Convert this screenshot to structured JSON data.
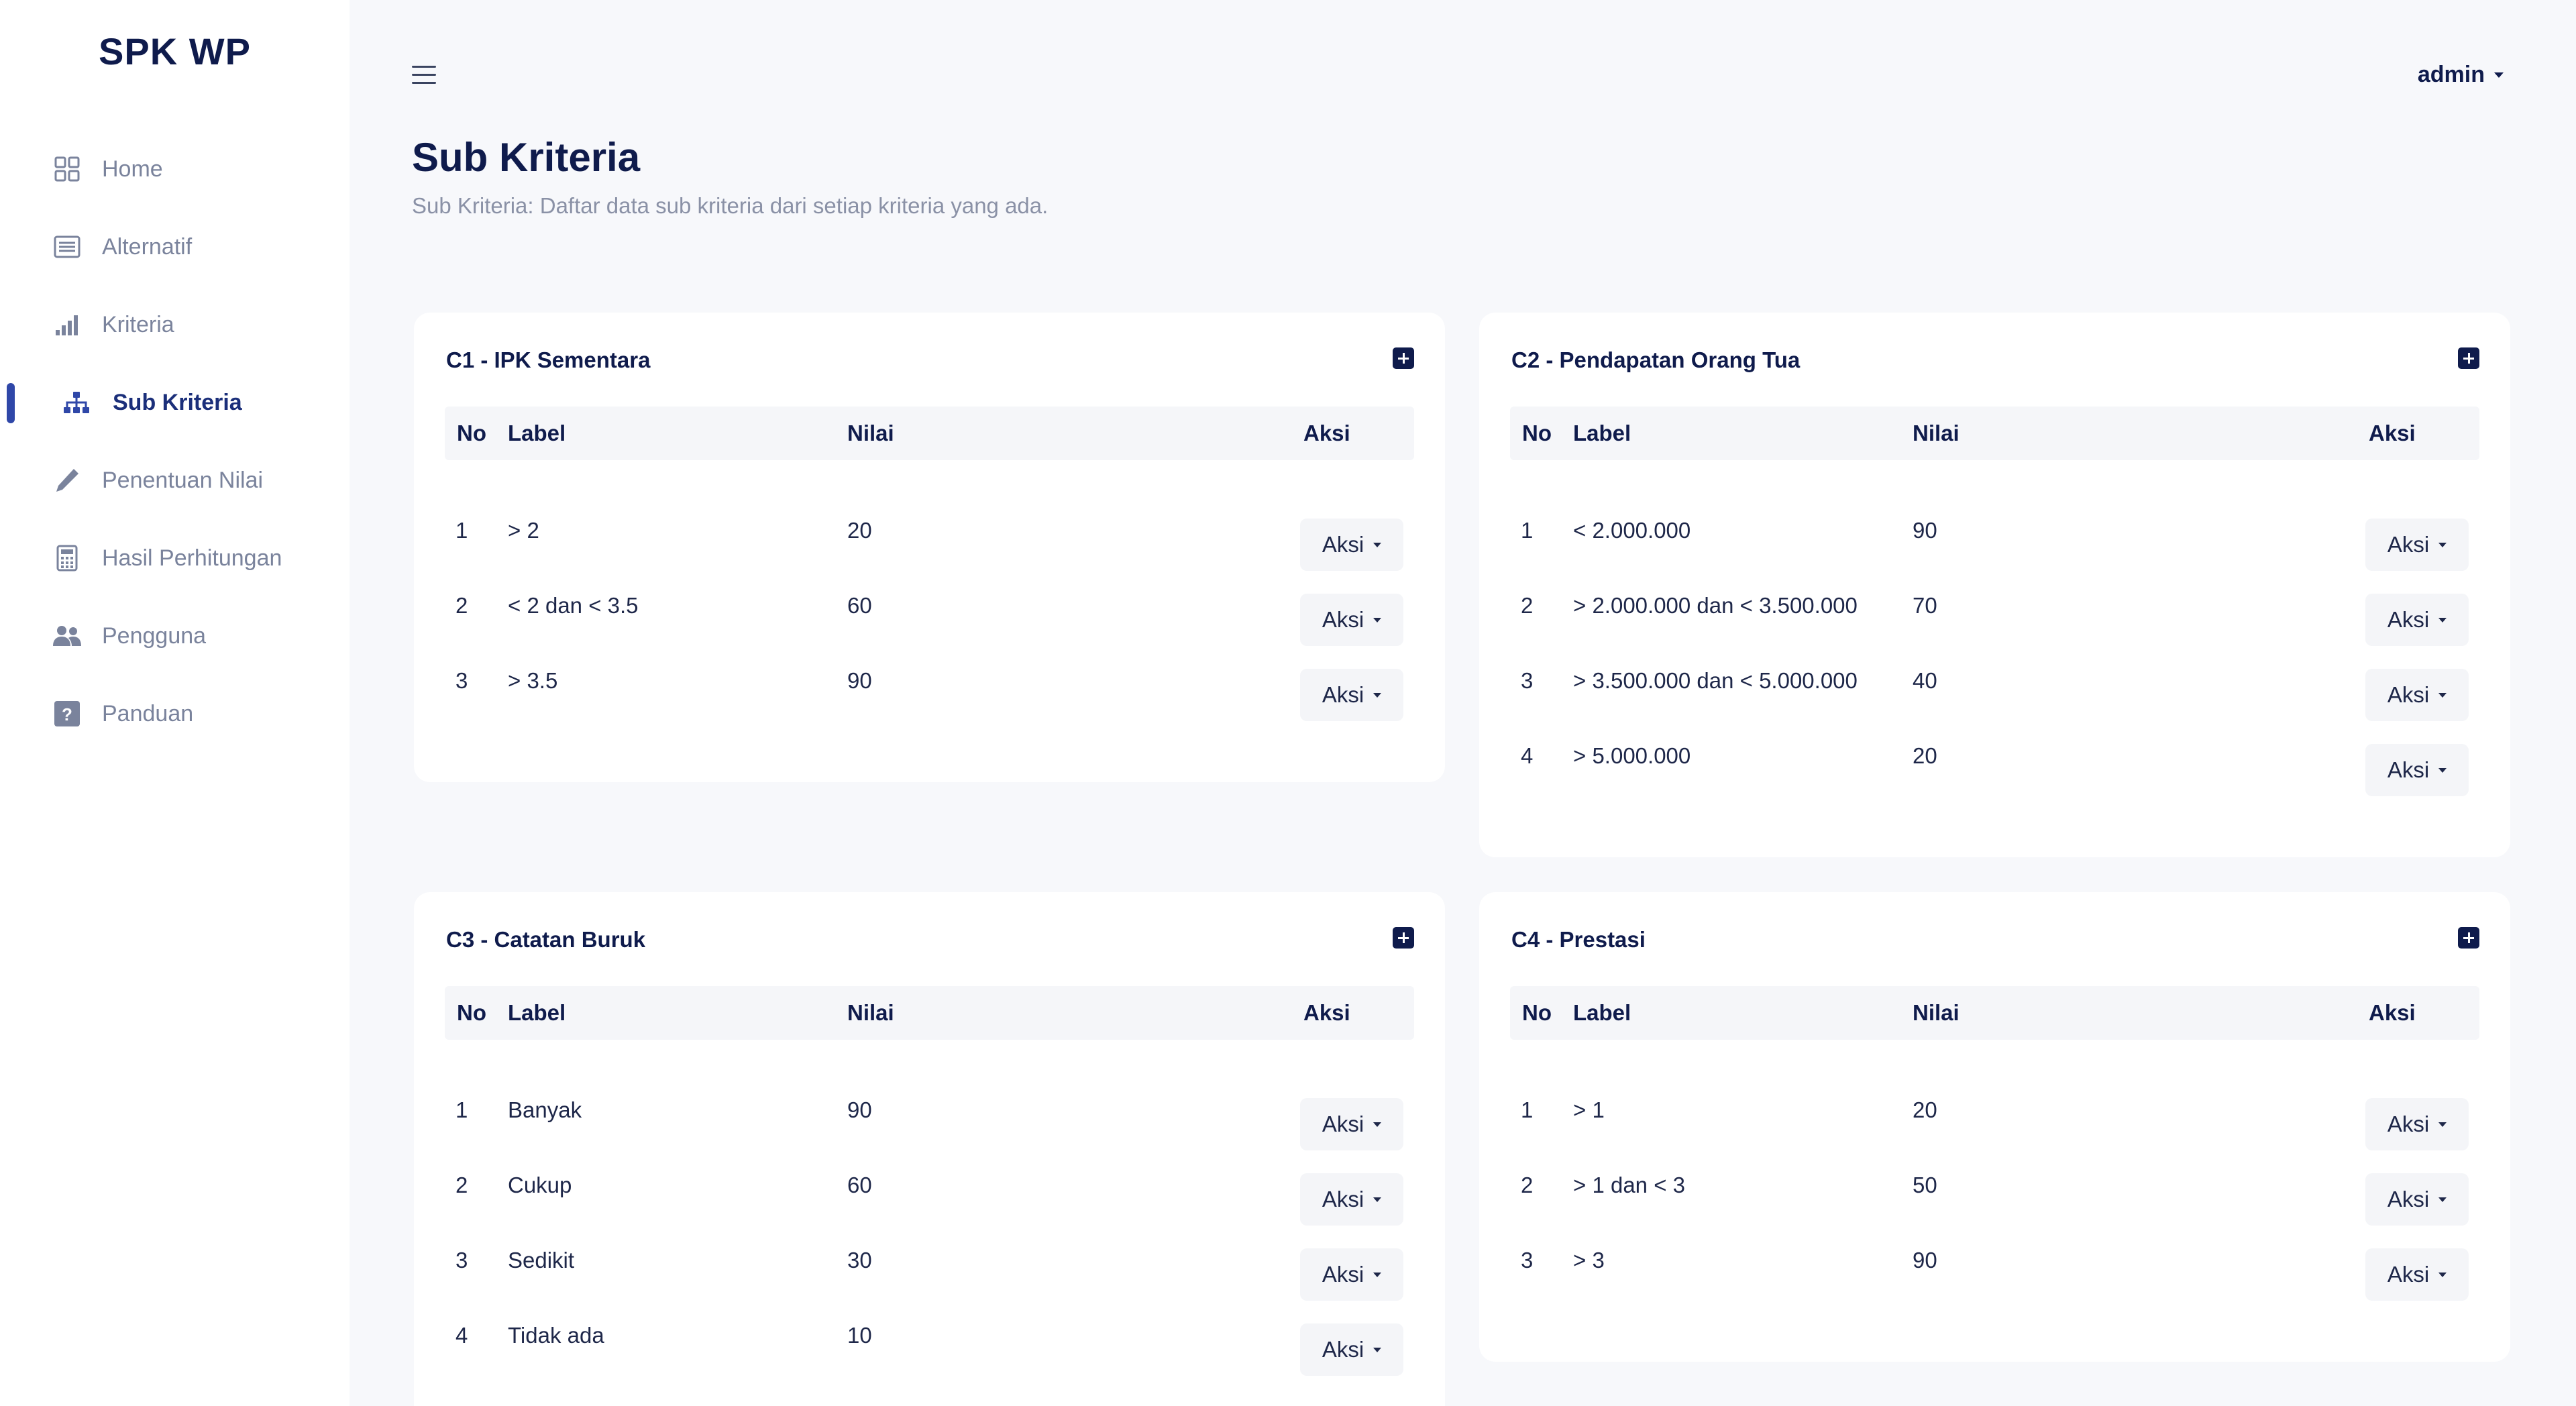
{
  "app": {
    "brand": "SPK WP"
  },
  "sidebar": {
    "items": [
      {
        "label": "Home",
        "icon": "dashboard-icon"
      },
      {
        "label": "Alternatif",
        "icon": "list-icon"
      },
      {
        "label": "Kriteria",
        "icon": "bar-chart-icon"
      },
      {
        "label": "Sub Kriteria",
        "icon": "sitemap-icon",
        "active": true
      },
      {
        "label": "Penentuan Nilai",
        "icon": "pen-icon"
      },
      {
        "label": "Hasil Perhitungan",
        "icon": "calculator-icon"
      },
      {
        "label": "Pengguna",
        "icon": "users-icon"
      },
      {
        "label": "Panduan",
        "icon": "question-icon"
      }
    ]
  },
  "header": {
    "user": "admin"
  },
  "page": {
    "title": "Sub Kriteria",
    "subtitle": "Sub Kriteria: Daftar data sub kriteria dari setiap kriteria yang ada."
  },
  "table_headers": {
    "no": "No",
    "label": "Label",
    "nilai": "Nilai",
    "aksi": "Aksi"
  },
  "cards": [
    {
      "title": "C1 - IPK Sementara",
      "rows": [
        {
          "no": "1",
          "label": "> 2",
          "nilai": "20",
          "aksi": "Aksi"
        },
        {
          "no": "2",
          "label": "< 2 dan < 3.5",
          "nilai": "60",
          "aksi": "Aksi"
        },
        {
          "no": "3",
          "label": "> 3.5",
          "nilai": "90",
          "aksi": "Aksi"
        }
      ]
    },
    {
      "title": "C2 - Pendapatan Orang Tua",
      "rows": [
        {
          "no": "1",
          "label": "< 2.000.000",
          "nilai": "90",
          "aksi": "Aksi"
        },
        {
          "no": "2",
          "label": "> 2.000.000 dan < 3.500.000",
          "nilai": "70",
          "aksi": "Aksi"
        },
        {
          "no": "3",
          "label": "> 3.500.000 dan < 5.000.000",
          "nilai": "40",
          "aksi": "Aksi"
        },
        {
          "no": "4",
          "label": "> 5.000.000",
          "nilai": "20",
          "aksi": "Aksi"
        }
      ]
    },
    {
      "title": "C3 - Catatan Buruk",
      "rows": [
        {
          "no": "1",
          "label": "Banyak",
          "nilai": "90",
          "aksi": "Aksi"
        },
        {
          "no": "2",
          "label": "Cukup",
          "nilai": "60",
          "aksi": "Aksi"
        },
        {
          "no": "3",
          "label": "Sedikit",
          "nilai": "30",
          "aksi": "Aksi"
        },
        {
          "no": "4",
          "label": "Tidak ada",
          "nilai": "10",
          "aksi": "Aksi"
        }
      ]
    },
    {
      "title": "C4 - Prestasi",
      "rows": [
        {
          "no": "1",
          "label": "> 1",
          "nilai": "20",
          "aksi": "Aksi"
        },
        {
          "no": "2",
          "label": "> 1 dan < 3",
          "nilai": "50",
          "aksi": "Aksi"
        },
        {
          "no": "3",
          "label": "> 3",
          "nilai": "90",
          "aksi": "Aksi"
        }
      ]
    }
  ]
}
